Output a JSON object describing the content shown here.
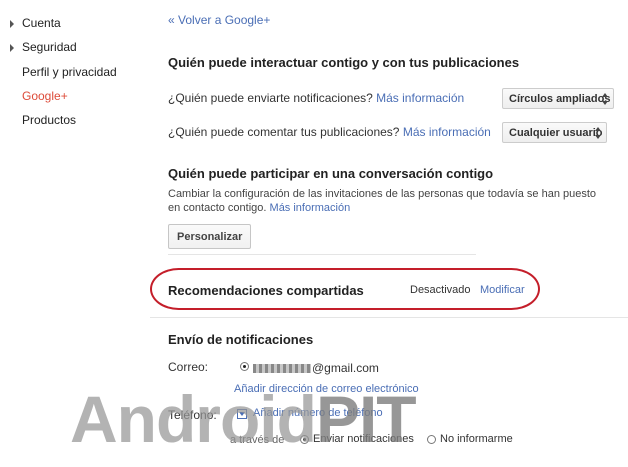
{
  "sidebar": {
    "items": [
      {
        "label": "Cuenta",
        "arrow": true
      },
      {
        "label": "Seguridad",
        "arrow": true
      },
      {
        "label": "Perfil y privacidad",
        "arrow": false
      },
      {
        "label": "Google+",
        "arrow": false,
        "active": true
      },
      {
        "label": "Productos",
        "arrow": false
      }
    ]
  },
  "back_link": "« Volver a Google+",
  "interact": {
    "title": "Quién puede interactuar contigo y con tus publicaciones",
    "notify_question": "¿Quién puede enviarte notificaciones?",
    "notify_select": "Círculos ampliados",
    "comment_question": "¿Quién puede comentar tus publicaciones?",
    "comment_select": "Cualquier usuario",
    "more_info": "Más información"
  },
  "conversation": {
    "title": "Quién puede participar en una conversación contigo",
    "desc_line1": "Cambiar la configuración de las invitaciones de las personas que todavía se han puesto",
    "desc_line2": "en contacto contigo.",
    "more_info": "Más información",
    "button": "Personalizar"
  },
  "shared_recs": {
    "title": "Recomendaciones compartidas",
    "status": "Desactivado",
    "modify": "Modificar"
  },
  "notifications": {
    "title": "Envío de notificaciones",
    "email_label": "Correo:",
    "email_suffix": "@gmail.com",
    "add_email": "Añadir dirección de correo electrónico",
    "phone_label": "Teléfono:",
    "add_phone": "Añadir número de teléfono",
    "via": "a través de",
    "send_option": "Enviar notificaciones",
    "no_inform_option": "No informarme"
  },
  "watermark": {
    "a": "Android",
    "b": "PIT"
  },
  "colors": {
    "link": "#4a6eb5",
    "active": "#dd4b39",
    "highlight_oval": "#c41e2a"
  }
}
